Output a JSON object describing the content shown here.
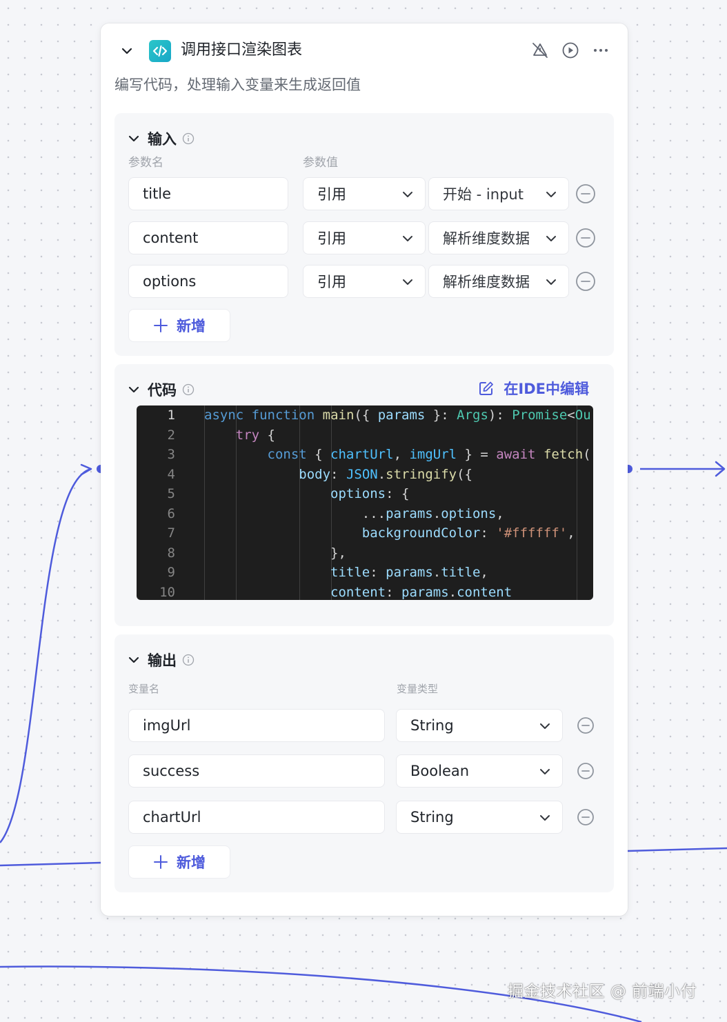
{
  "node": {
    "title": "调用接口渲染图表",
    "description": "编写代码，处理输入变量来生成返回值"
  },
  "input_section": {
    "title": "输入",
    "col_name": "参数名",
    "col_value": "参数值",
    "rows": [
      {
        "name": "title",
        "type": "引用",
        "value": "开始 - input"
      },
      {
        "name": "content",
        "type": "引用",
        "value": "解析维度数据"
      },
      {
        "name": "options",
        "type": "引用",
        "value": "解析维度数据"
      }
    ],
    "add_label": "新增"
  },
  "code_section": {
    "title": "代码",
    "ide_label": "在IDE中编辑",
    "line_numbers": [
      "1",
      "2",
      "3",
      "4",
      "5",
      "6",
      "7",
      "8",
      "9",
      "10"
    ]
  },
  "output_section": {
    "title": "输出",
    "col_name": "变量名",
    "col_type": "变量类型",
    "rows": [
      {
        "name": "imgUrl",
        "type": "String"
      },
      {
        "name": "success",
        "type": "Boolean"
      },
      {
        "name": "chartUrl",
        "type": "String"
      }
    ],
    "add_label": "新增"
  },
  "watermark": "掘金技术社区 @ 前端小付",
  "colors": {
    "accent": "#4e5bdc",
    "icon_teal": "#1fb5c8",
    "code_bg": "#1e1e1e"
  }
}
